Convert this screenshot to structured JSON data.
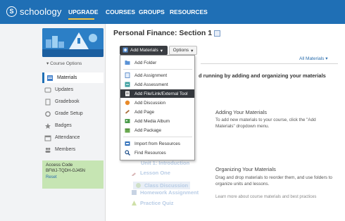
{
  "topnav": {
    "logo_mark": "S",
    "logo_text": "schoology",
    "items": [
      {
        "label": "UPGRADE",
        "active": true
      },
      {
        "label": "COURSES"
      },
      {
        "label": "GROUPS"
      },
      {
        "label": "RESOURCES"
      }
    ],
    "colors": {
      "bar": "#1f6fb5",
      "underline": "#f5c542"
    }
  },
  "sidebar": {
    "course_options": "▾ Course Options",
    "items": [
      {
        "label": "Materials",
        "icon": "materials-icon"
      },
      {
        "label": "Updates",
        "icon": "updates-icon"
      },
      {
        "label": "Gradebook",
        "icon": "gradebook-icon"
      },
      {
        "label": "Grade Setup",
        "icon": "grade-setup-icon"
      },
      {
        "label": "Badges",
        "icon": "badge-icon"
      },
      {
        "label": "Attendance",
        "icon": "attendance-icon"
      },
      {
        "label": "Members",
        "icon": "members-icon"
      }
    ],
    "access": {
      "title": "Access Code",
      "code": "BFWJ-TQDH-GJ45N",
      "reset": "Reset"
    }
  },
  "main": {
    "title": "Personal Finance: Section 1",
    "add_materials_label": "Add Materials",
    "options_label": "Options",
    "all_materials_label": "All Materials",
    "welcome_text": "d running by adding and organizing your materials",
    "adding_heading": "Adding Your Materials",
    "adding_text": "To add new materials to your course, click the \"Add Materials\" dropdown menu.",
    "organizing_heading": "Organizing Your Materials",
    "organizing_text": "Drag and drop materials to reorder them, and use folders to organize units and lessons.",
    "learn_more": "Learn more about course materials and best practices",
    "ghost_items": [
      "Unit 1: Introduction",
      "Lesson One",
      "Class Discussion",
      "Homework Assignment",
      "Practice Quiz"
    ]
  },
  "menu": {
    "items": [
      {
        "label": "Add Folder",
        "icon": "folder-icon"
      },
      {
        "label": "Add Assignment",
        "icon": "assignment-icon"
      },
      {
        "label": "Add Assessment",
        "icon": "assessment-icon"
      },
      {
        "label": "Add File/Link/External Tool",
        "icon": "file-link-icon",
        "highlighted": true
      },
      {
        "label": "Add Discussion",
        "icon": "discussion-icon"
      },
      {
        "label": "Add Page",
        "icon": "page-icon"
      },
      {
        "label": "Add Media Album",
        "icon": "media-album-icon"
      },
      {
        "label": "Add Package",
        "icon": "package-icon"
      },
      {
        "label": "Import from Resources",
        "icon": "import-icon"
      },
      {
        "label": "Find Resources",
        "icon": "find-icon"
      }
    ]
  }
}
